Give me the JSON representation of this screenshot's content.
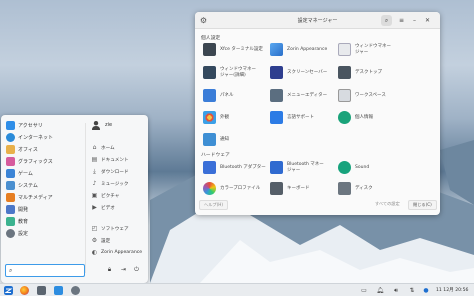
{
  "settings_window": {
    "title": "設定マネージャー",
    "personal_section": "個人設定",
    "hardware_section": "ハードウェア",
    "personal_items": [
      {
        "label": "Xfce ターミナル設定",
        "icon": "terminal-settings-icon"
      },
      {
        "label": "Zorin Appearance",
        "icon": "zorin-appearance-icon"
      },
      {
        "label": "ウィンドウマネー\nジャー",
        "icon": "window-manager-icon"
      },
      {
        "label": "ウィンドウマネー\nジャー(詳細)",
        "icon": "window-manager-tweaks-icon"
      },
      {
        "label": "スクリーンセーバー",
        "icon": "screensaver-icon"
      },
      {
        "label": "デスクトップ",
        "icon": "desktop-icon"
      },
      {
        "label": "パネル",
        "icon": "panel-icon"
      },
      {
        "label": "メニューエディター",
        "icon": "menu-editor-icon"
      },
      {
        "label": "ワークスペース",
        "icon": "workspaces-icon"
      },
      {
        "label": "外観",
        "icon": "appearance-icon"
      },
      {
        "label": "言語サポート",
        "icon": "language-support-icon"
      },
      {
        "label": "個人情報",
        "icon": "personal-info-icon"
      },
      {
        "label": "通知",
        "icon": "notifications-icon"
      }
    ],
    "hardware_items": [
      {
        "label": "Bluetooth アダプター",
        "icon": "bluetooth-adapter-icon"
      },
      {
        "label": "Bluetooth マネー\nジャー",
        "icon": "bluetooth-manager-icon"
      },
      {
        "label": "Sound",
        "icon": "sound-icon"
      },
      {
        "label": "カラープロファイル",
        "icon": "color-profile-icon"
      },
      {
        "label": "キーボード",
        "icon": "keyboard-icon"
      },
      {
        "label": "ディスク",
        "icon": "disk-icon"
      }
    ],
    "footer": {
      "help": "ヘルプ(H)",
      "all_settings": "すべての設定",
      "close": "閉じる(C)"
    }
  },
  "start_menu": {
    "categories": [
      {
        "label": "アクセサリ",
        "icon": "accessories-icon",
        "color": "#2f8ee8"
      },
      {
        "label": "インターネット",
        "icon": "internet-icon",
        "color": "#2a8bd9"
      },
      {
        "label": "オフィス",
        "icon": "office-icon",
        "color": "#e8b04a"
      },
      {
        "label": "グラフィックス",
        "icon": "graphics-icon",
        "color": "#d65b9d"
      },
      {
        "label": "ゲーム",
        "icon": "games-icon",
        "color": "#3b84d6"
      },
      {
        "label": "システム",
        "icon": "system-icon",
        "color": "#4a8fd0"
      },
      {
        "label": "マルチメディア",
        "icon": "multimedia-icon",
        "color": "#e67e22"
      },
      {
        "label": "開発",
        "icon": "development-icon",
        "color": "#4b77c8"
      },
      {
        "label": "教育",
        "icon": "education-icon",
        "color": "#3bb28f"
      },
      {
        "label": "設定",
        "icon": "settings-icon",
        "color": "#6b7580"
      }
    ],
    "user": {
      "name": "zie"
    },
    "places": [
      {
        "label": "ホーム",
        "icon": "home-icon"
      },
      {
        "label": "ドキュメント",
        "icon": "documents-icon"
      },
      {
        "label": "ダウンロード",
        "icon": "downloads-icon"
      },
      {
        "label": "ミュージック",
        "icon": "music-icon"
      },
      {
        "label": "ピクチャ",
        "icon": "pictures-icon"
      },
      {
        "label": "ビデオ",
        "icon": "videos-icon"
      },
      {
        "label": "ソフトウェア",
        "icon": "software-icon"
      },
      {
        "label": "設定",
        "icon": "settings-gear-icon"
      },
      {
        "label": "Zorin Appearance",
        "icon": "zorin-appearance-small-icon"
      }
    ],
    "search": {
      "value": "",
      "placeholder": ""
    },
    "power_icons": [
      "lock-icon",
      "logout-icon",
      "power-icon"
    ]
  },
  "taskbar": {
    "clock": "11 12月 20:56",
    "apps": [
      "zorin-menu-icon",
      "firefox-icon",
      "files-icon",
      "software-store-icon",
      "settings-app-icon"
    ],
    "tray": [
      "display-icon",
      "notification-icon",
      "volume-icon",
      "network-icon"
    ]
  }
}
